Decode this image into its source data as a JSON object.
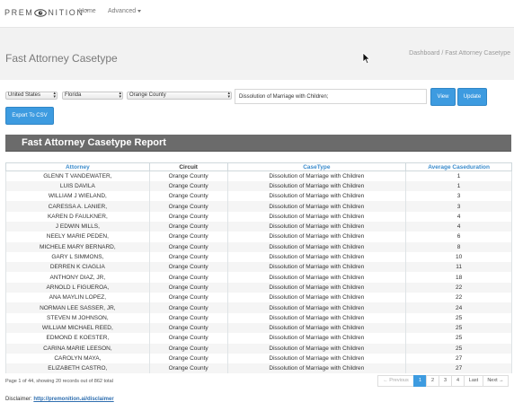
{
  "navbar": {
    "brand_left": "PREM",
    "brand_right": "NITION",
    "trademark": "™",
    "home_label": "Home",
    "advanced_label": "Advanced"
  },
  "header": {
    "title": "Fast Attorney Casetype",
    "breadcrumb": "Dashboard / Fast Attorney Casetype"
  },
  "filters": {
    "country": "United States",
    "state": "Florida",
    "county": "Orange County",
    "casetype": "Dissolution of Marriage with Children;",
    "view_label": "View",
    "update_label": "Update",
    "export_label": "Export To CSV"
  },
  "report": {
    "title": "Fast Attorney Casetype Report",
    "columns": [
      "Attorney",
      "Circuit",
      "CaseType",
      "Average Caseduration"
    ],
    "rows": [
      [
        "GLENN T VANDEWATER,",
        "Orange County",
        "Dissolution of Marriage with Children",
        "1"
      ],
      [
        "LUIS DAVILA",
        "Orange County",
        "Dissolution of Marriage with Children",
        "1"
      ],
      [
        "WILLIAM J WIELAND,",
        "Orange County",
        "Dissolution of Marriage with Children",
        "3"
      ],
      [
        "CARESSA A. LANIER,",
        "Orange County",
        "Dissolution of Marriage with Children",
        "3"
      ],
      [
        "KAREN D FAULKNER,",
        "Orange County",
        "Dissolution of Marriage with Children",
        "4"
      ],
      [
        "J EDWIN MILLS,",
        "Orange County",
        "Dissolution of Marriage with Children",
        "4"
      ],
      [
        "NEELY MARIE PEDEN,",
        "Orange County",
        "Dissolution of Marriage with Children",
        "6"
      ],
      [
        "MICHELE MARY BERNARD,",
        "Orange County",
        "Dissolution of Marriage with Children",
        "8"
      ],
      [
        "GARY L SIMMONS,",
        "Orange County",
        "Dissolution of Marriage with Children",
        "10"
      ],
      [
        "DERREN K CIAGLIA",
        "Orange County",
        "Dissolution of Marriage with Children",
        "11"
      ],
      [
        "ANTHONY DIAZ, JR,",
        "Orange County",
        "Dissolution of Marriage with Children",
        "18"
      ],
      [
        "ARNOLD L FIGUEROA,",
        "Orange County",
        "Dissolution of Marriage with Children",
        "22"
      ],
      [
        "ANA MAYLIN LOPEZ,",
        "Orange County",
        "Dissolution of Marriage with Children",
        "22"
      ],
      [
        "NORMAN LEE SASSER, JR,",
        "Orange County",
        "Dissolution of Marriage with Children",
        "24"
      ],
      [
        "STEVEN M JOHNSON,",
        "Orange County",
        "Dissolution of Marriage with Children",
        "25"
      ],
      [
        "WILLIAM MICHAEL REED,",
        "Orange County",
        "Dissolution of Marriage with Children",
        "25"
      ],
      [
        "EDMOND E KOESTER,",
        "Orange County",
        "Dissolution of Marriage with Children",
        "25"
      ],
      [
        "CARINA MARIE LEESON,",
        "Orange County",
        "Dissolution of Marriage with Children",
        "25"
      ],
      [
        "CAROLYN MAYA,",
        "Orange County",
        "Dissolution of Marriage with Children",
        "27"
      ],
      [
        "ELIZABETH CASTRO,",
        "Orange County",
        "Dissolution of Marriage with Children",
        "27"
      ]
    ]
  },
  "pagination": {
    "info": "Page 1 of 44, showing 20 records out of 862 total",
    "prev_label": "← Previous",
    "pages": [
      "1",
      "2",
      "3",
      "4"
    ],
    "active_page": "1",
    "last_label": "Last",
    "next_label": "Next →"
  },
  "footer": {
    "disclaimer_label": "Disclaimer:",
    "disclaimer_link": "http://premonition.ai/disclaimer"
  },
  "colors": {
    "accent": "#3d9be0",
    "report_bar": "#6b6b6b",
    "header_bg": "#f2f2f2",
    "link": "#3a8bcc"
  },
  "icons": {
    "brand_eye": "eye-icon",
    "dropdown": "caret-down-icon",
    "cursor": "mouse-pointer-icon"
  }
}
